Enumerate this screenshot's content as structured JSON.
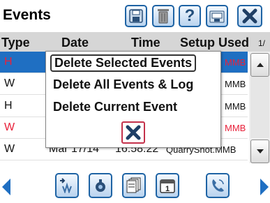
{
  "header": {
    "title": "Events"
  },
  "toolbar": {
    "save_icon": "save-icon",
    "delete_icon": "trash-icon",
    "help_icon": "help-icon",
    "export_icon": "export-icon",
    "close_icon": "close-icon"
  },
  "table": {
    "columns": [
      "Type",
      "Date",
      "Time",
      "Setup Used",
      "1/"
    ],
    "rows": [
      {
        "type": "H",
        "setup_tail": "MMB",
        "color": "#e8213a",
        "selected": true
      },
      {
        "type": "W",
        "setup_tail": "MMB",
        "color": "#111111",
        "selected": false
      },
      {
        "type": "H",
        "setup_tail": "MMB",
        "color": "#111111",
        "selected": false
      },
      {
        "type": "W",
        "setup_tail": "MMB",
        "color": "#e8213a",
        "selected": false
      },
      {
        "type": "W",
        "date": "Mar 17/14",
        "time": "16:58:22",
        "setup": "QuarryShot.MMB",
        "color": "#111111",
        "selected": false
      }
    ]
  },
  "dialog": {
    "options": [
      "Delete Selected Events",
      "Delete All Events & Log",
      "Delete Current Event"
    ],
    "close_icon": "close-icon"
  },
  "footer": {
    "icons": [
      "waveform-icon",
      "seismograph-icon",
      "documents-icon",
      "calendar-icon",
      "phone-icon"
    ]
  },
  "colors": {
    "accent": "#1e63a4",
    "selected_row": "#1f6fc2",
    "alert_red": "#e8213a",
    "header_gray": "#d6d6d6"
  }
}
